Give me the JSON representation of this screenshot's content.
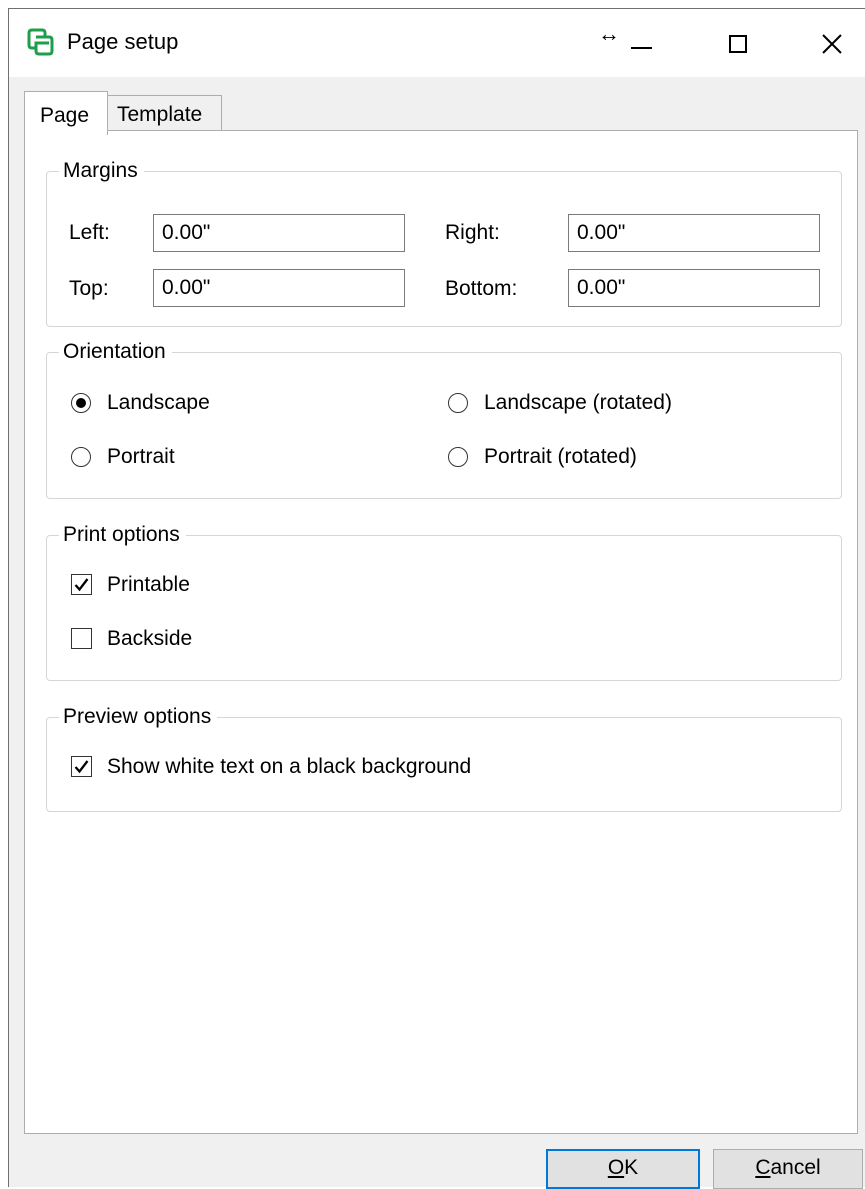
{
  "window": {
    "title": "Page setup"
  },
  "tabs": [
    {
      "label": "Page"
    },
    {
      "label": "Template"
    }
  ],
  "margins": {
    "title": "Margins",
    "left_label": "Left:",
    "left_value": "0.00\"",
    "right_label": "Right:",
    "right_value": "0.00\"",
    "top_label": "Top:",
    "top_value": "0.00\"",
    "bottom_label": "Bottom:",
    "bottom_value": "0.00\""
  },
  "orientation": {
    "title": "Orientation",
    "options": [
      {
        "label": "Landscape",
        "selected": true
      },
      {
        "label": "Landscape (rotated)",
        "selected": false
      },
      {
        "label": "Portrait",
        "selected": false
      },
      {
        "label": "Portrait (rotated)",
        "selected": false
      }
    ]
  },
  "print_options": {
    "title": "Print options",
    "printable": {
      "label": "Printable",
      "checked": true
    },
    "backside": {
      "label": "Backside",
      "checked": false
    }
  },
  "preview_options": {
    "title": "Preview options",
    "white_on_black": {
      "label": "Show white text on a black background",
      "checked": true
    }
  },
  "buttons": {
    "ok": {
      "accel": "O",
      "rest": "K"
    },
    "cancel": {
      "accel": "C",
      "rest": "ancel"
    }
  },
  "icons": {
    "app": "app-logo-icon",
    "resize": "resize-horizontal-icon",
    "minimize": "minimize-icon",
    "maximize": "maximize-icon",
    "close": "close-icon"
  },
  "colors": {
    "accent": "#0078d7",
    "app_icon": "#1e9e4a"
  }
}
